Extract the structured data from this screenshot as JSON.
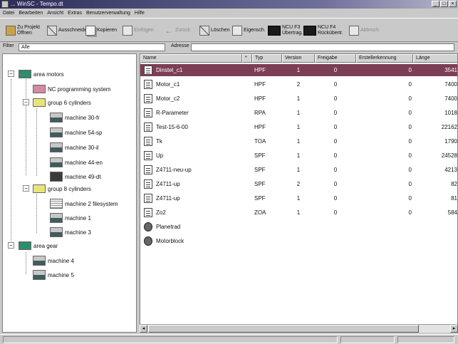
{
  "window": {
    "title": "... WinSC - Tempo.dt",
    "controls": [
      "_",
      "□",
      "×"
    ]
  },
  "menu": [
    {
      "label": "Datei"
    },
    {
      "label": "Bearbeiten"
    },
    {
      "label": "Ansicht"
    },
    {
      "label": "Extras"
    },
    {
      "label": "Benutzerverwaltung"
    },
    {
      "label": "Hilfe"
    }
  ],
  "toolbar": {
    "buttons": [
      {
        "label": "Zu Projekt",
        "sub": "Öffnen",
        "icon": "clipboard-icon",
        "enabled": true
      },
      {
        "label": "Ausschneiden",
        "sub": "",
        "icon": "cut-icon",
        "enabled": true
      },
      {
        "label": "Kopieren",
        "sub": "",
        "icon": "copy-icon",
        "enabled": true
      },
      {
        "label": "Einfügen",
        "sub": "",
        "icon": "paste-icon",
        "enabled": false
      },
      {
        "label": "Zurück",
        "sub": "",
        "icon": "arrow-left-icon",
        "enabled": false
      },
      {
        "label": "Löschen",
        "sub": "",
        "icon": "delete-icon",
        "enabled": true
      },
      {
        "label": "Eigensch.",
        "sub": "",
        "icon": "properties-icon",
        "enabled": true
      },
      {
        "label": "Übertrag.",
        "sub": "NCU F3",
        "icon": "ncu-transfer-icon",
        "enabled": true
      },
      {
        "label": "Rückübertr.",
        "sub": "NCU F4",
        "icon": "ncu-receive-icon",
        "enabled": true
      },
      {
        "label": "Abbruch",
        "sub": "",
        "icon": "cancel-icon",
        "enabled": false
      }
    ]
  },
  "address": {
    "label": "Filter",
    "value": "Alle",
    "label2": "Adresse",
    "value2": ""
  },
  "tree": {
    "nodes": [
      {
        "label": "area motors",
        "icon": "area-folder-icon",
        "level": 0,
        "expander": "−"
      },
      {
        "label": "NC programming system",
        "icon": "nc-folder-icon",
        "level": 1,
        "expander": ""
      },
      {
        "label": "group 6 cylinders",
        "icon": "group-folder-icon",
        "level": 1,
        "expander": "−"
      },
      {
        "label": "machine 30-fr",
        "icon": "machine-icon",
        "level": 2,
        "expander": ""
      },
      {
        "label": "machine 54-sp",
        "icon": "machine-icon",
        "level": 2,
        "expander": ""
      },
      {
        "label": "machine 30-il",
        "icon": "machine-icon",
        "level": 2,
        "expander": ""
      },
      {
        "label": "machine 44-en",
        "icon": "machine-icon",
        "level": 2,
        "expander": ""
      },
      {
        "label": "machine 49-dt",
        "icon": "machine-dark-icon",
        "level": 2,
        "expander": ""
      },
      {
        "label": "group 8 cylinders",
        "icon": "group-folder-icon",
        "level": 1,
        "expander": "−"
      },
      {
        "label": "machine 2 filesystem",
        "icon": "machine-fs-icon",
        "level": 2,
        "expander": ""
      },
      {
        "label": "machine 1",
        "icon": "machine-icon",
        "level": 2,
        "expander": ""
      },
      {
        "label": "machine 3",
        "icon": "machine-icon",
        "level": 2,
        "expander": ""
      },
      {
        "label": "area gear",
        "icon": "area-folder-icon",
        "level": 0,
        "expander": "−"
      },
      {
        "label": "machine 4",
        "icon": "machine-icon",
        "level": 1,
        "expander": ""
      },
      {
        "label": "machine 5",
        "icon": "machine-icon",
        "level": 1,
        "expander": ""
      }
    ]
  },
  "list": {
    "columns": [
      "Name",
      "*",
      "Typ",
      "Version",
      "Freigabe",
      "Erstellerkennung",
      "Länge"
    ],
    "rows": [
      {
        "name": "Dinstel_c1",
        "star": "",
        "type": "HPF",
        "version": "1",
        "release": "0",
        "creator": "0",
        "length": "3541",
        "icon": "document-icon",
        "selected": true
      },
      {
        "name": "Motor_c1",
        "star": "",
        "type": "HPF",
        "version": "2",
        "release": "0",
        "creator": "0",
        "length": "7400",
        "icon": "document-icon",
        "selected": false
      },
      {
        "name": "Motor_c2",
        "star": "",
        "type": "HPF",
        "version": "1",
        "release": "0",
        "creator": "0",
        "length": "7400",
        "icon": "document-icon",
        "selected": false
      },
      {
        "name": "R-Parameter",
        "star": "",
        "type": "RPA",
        "version": "1",
        "release": "0",
        "creator": "0",
        "length": "1018",
        "icon": "document-icon",
        "selected": false
      },
      {
        "name": "Test-15-6-00",
        "star": "",
        "type": "HPF",
        "version": "1",
        "release": "0",
        "creator": "0",
        "length": "22162",
        "icon": "document-icon",
        "selected": false
      },
      {
        "name": "Tk",
        "star": "",
        "type": "TOA",
        "version": "1",
        "release": "0",
        "creator": "0",
        "length": "1790",
        "icon": "document-icon",
        "selected": false
      },
      {
        "name": "Up",
        "star": "",
        "type": "SPF",
        "version": "1",
        "release": "0",
        "creator": "0",
        "length": "24528",
        "icon": "document-icon",
        "selected": false
      },
      {
        "name": "Z4711-neu-up",
        "star": "",
        "type": "SPF",
        "version": "1",
        "release": "0",
        "creator": "0",
        "length": "4213",
        "icon": "document-icon",
        "selected": false
      },
      {
        "name": "Z4711-up",
        "star": "",
        "type": "SPF",
        "version": "2",
        "release": "0",
        "creator": "0",
        "length": "82",
        "icon": "document-icon",
        "selected": false
      },
      {
        "name": "Z4711-up",
        "star": "",
        "type": "SPF",
        "version": "1",
        "release": "0",
        "creator": "0",
        "length": "81",
        "icon": "document-icon",
        "selected": false
      },
      {
        "name": "Zo2",
        "star": "",
        "type": "ZOA",
        "version": "1",
        "release": "0",
        "creator": "0",
        "length": "584",
        "icon": "document-icon",
        "selected": false
      },
      {
        "name": "Planetrad",
        "star": "",
        "type": "",
        "version": "",
        "release": "",
        "creator": "",
        "length": "",
        "icon": "gear-folder-icon",
        "selected": false
      },
      {
        "name": "Motorblock",
        "star": "",
        "type": "",
        "version": "",
        "release": "",
        "creator": "",
        "length": "",
        "icon": "gear-folder-icon",
        "selected": false
      }
    ]
  },
  "colors": {
    "selection": "#7c3e55",
    "area_folder": "#2e8d6c",
    "nc_folder": "#d48aa2",
    "group_folder": "#e9e47a"
  }
}
